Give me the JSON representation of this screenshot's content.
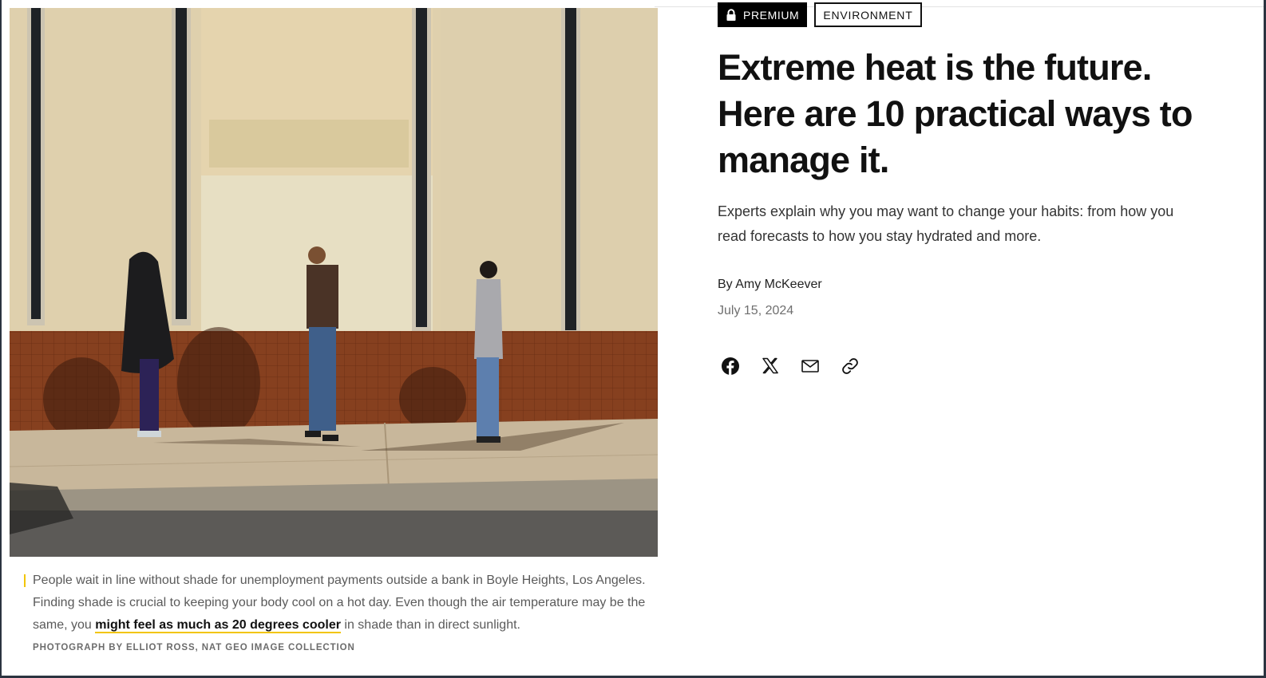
{
  "photo": {
    "alt_icon": "photo-image",
    "colors": {
      "wall": "#ded0ad",
      "tile": "#8a3f22",
      "sidewalk": "#c7b59a",
      "street": "#5a5855"
    }
  },
  "caption": {
    "before": "People wait in line without shade for unemployment payments outside a bank in Boyle Heights, Los Angeles. Finding shade is crucial to keeping your body cool on a hot day. Even though the air temperature may be the same, you ",
    "link": "might feel as much as 20 degrees cooler",
    "after": " in shade than in direct sunlight.",
    "credit": "PHOTOGRAPH BY ELLIOT ROSS, NAT GEO IMAGE COLLECTION"
  },
  "tags": {
    "premium": "PREMIUM",
    "category": "ENVIRONMENT",
    "premium_icon": "lock-icon"
  },
  "article": {
    "headline": "Extreme heat is the future. Here are 10 practical ways to manage it.",
    "dek": "Experts explain why you may want to change your habits: from how you read forecasts to how you stay hydrated and more.",
    "byline": "By Amy McKeever",
    "date": "July 15, 2024"
  },
  "share": {
    "icons": [
      "facebook-icon",
      "x-icon",
      "email-icon",
      "link-icon"
    ]
  },
  "colors": {
    "accent": "#f2c500",
    "text": "#111111",
    "muted": "#6f6f6f"
  }
}
